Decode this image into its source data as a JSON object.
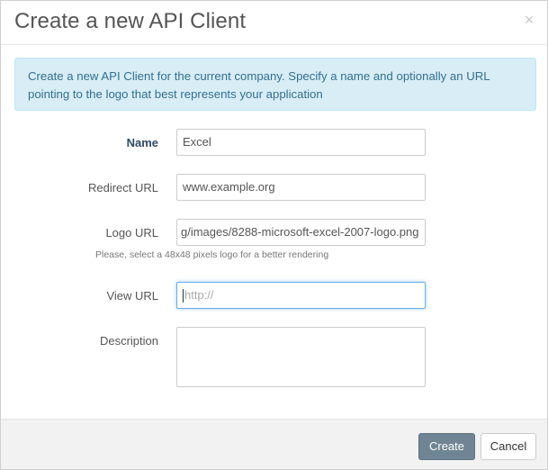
{
  "dialog": {
    "title": "Create a new API Client",
    "close_icon": "×"
  },
  "alert": {
    "text": "Create a new API Client for the current company. Specify a name and optionally an URL pointing to the logo that best represents your application"
  },
  "form": {
    "name": {
      "label": "Name",
      "value": "Excel"
    },
    "redirect_url": {
      "label": "Redirect URL",
      "value": "www.example.org"
    },
    "logo_url": {
      "label": "Logo URL",
      "value": "g/images/8288-microsoft-excel-2007-logo.png",
      "help": "Please, select a 48x48 pixels logo for a better rendering"
    },
    "view_url": {
      "label": "View URL",
      "placeholder": "http://"
    },
    "description": {
      "label": "Description",
      "value": ""
    }
  },
  "footer": {
    "create_label": "Create",
    "cancel_label": "Cancel"
  },
  "colors": {
    "alert_bg": "#d9edf7",
    "alert_text": "#31708f",
    "primary_button": "#6f8593",
    "focus_border": "#66afe9"
  }
}
